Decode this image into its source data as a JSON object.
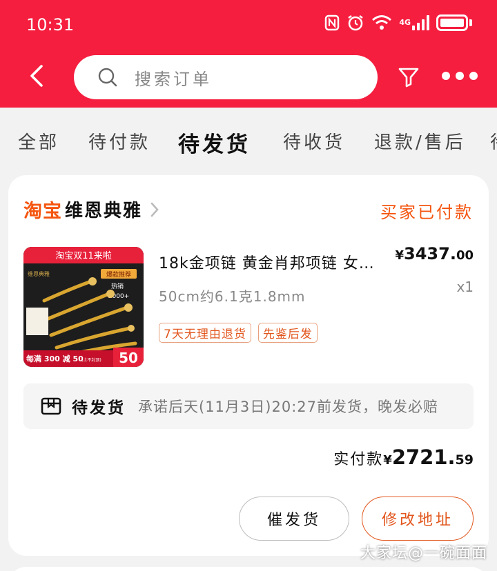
{
  "status_bar": {
    "time": "10:31",
    "network": "4G"
  },
  "header": {
    "search_placeholder": "搜索订单",
    "icons": [
      "back-arrow-icon",
      "search-icon",
      "filter-icon",
      "more-icon"
    ]
  },
  "tabs": [
    {
      "label": "全部"
    },
    {
      "label": "待付款"
    },
    {
      "label": "待发货",
      "active": true
    },
    {
      "label": "待收货"
    },
    {
      "label": "退款/售后"
    },
    {
      "label": "待"
    }
  ],
  "order": {
    "platform": "淘宝",
    "store_name": "维恩典雅",
    "status": "买家已付款",
    "product": {
      "title": "18k金项链 黄金肖邦项链 女…",
      "spec": "50cm约6.1克1.8mm",
      "price_yen": "¥",
      "price_int": "3437.",
      "price_cents": "00",
      "qty": "x1",
      "tags": [
        "7天无理由退货",
        "先鉴后发"
      ],
      "image_text": {
        "banner": "淘宝双11来啦",
        "brand": "维恩典雅",
        "hot_badge": "爆款推荐",
        "sales_label": "热销",
        "sales_count": "2000+",
        "promo": "每满 300 减 50",
        "promo_note": "(上不封顶)",
        "promo_big": "50"
      }
    },
    "shipping": {
      "status": "待发货",
      "note": "承诺后天(11月3日)20:27前发货，晚发必赔"
    },
    "payment": {
      "label": "实付款",
      "yen": "¥",
      "amount_int": "2721.",
      "amount_cents": "59"
    },
    "buttons": {
      "urge": "催发货",
      "address": "修改地址"
    }
  },
  "watermark": "大家坛@一碗面面",
  "colors": {
    "brand_red": "#f51e3f",
    "accent_orange": "#e2561d"
  }
}
